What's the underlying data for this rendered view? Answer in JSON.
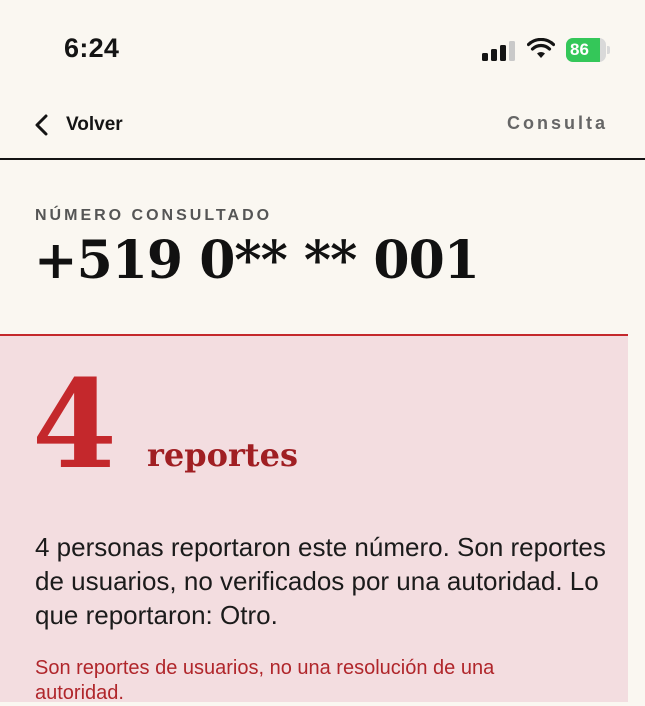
{
  "status_bar": {
    "time": "6:24",
    "battery_level": "86",
    "battery_fraction": 0.86,
    "icons": [
      "signal-icon",
      "wifi-icon",
      "battery-icon"
    ],
    "battery_color": "#34c759"
  },
  "nav": {
    "back_label": "Volver",
    "title": "Consulta",
    "icons": [
      "chevron-left-icon"
    ]
  },
  "number": {
    "label": "NÚMERO CONSULTADO",
    "value": "+519 0** ** 001"
  },
  "report": {
    "count": "4",
    "unit": "reportes",
    "summary": "4 personas reportaron este número. Son reportes de usuarios, no verificados por una autoridad. Lo que reportaron: Otro.",
    "disclaimer": "Son reportes de usuarios, no una resolución de una autoridad.",
    "accent_color": "#c4282c",
    "panel_color": "#f3dde0"
  }
}
